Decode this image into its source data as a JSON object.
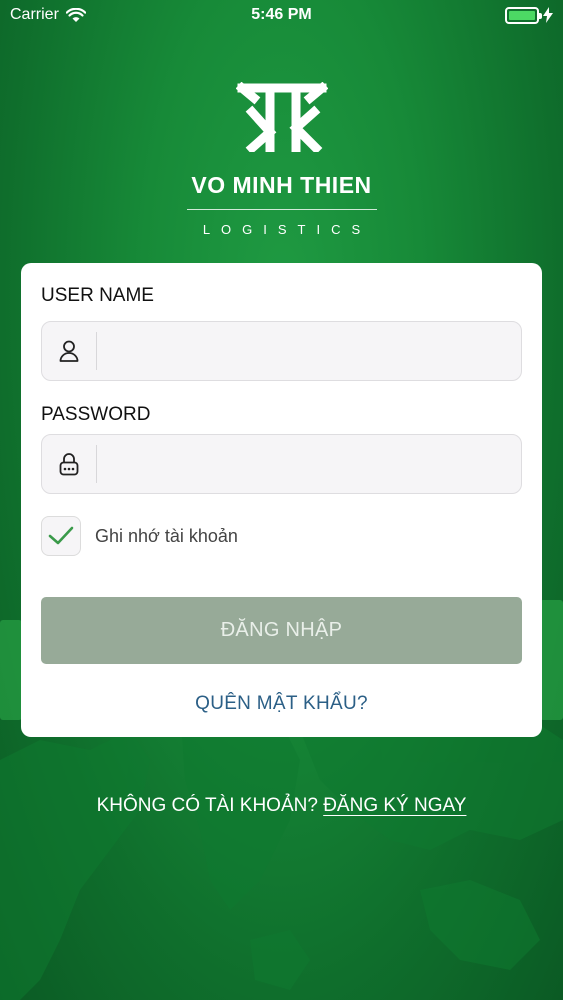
{
  "status_bar": {
    "carrier": "Carrier",
    "time": "5:46 PM",
    "battery_color": "#4cd964"
  },
  "brand": {
    "name": "VO MINH THIEN",
    "subtitle": "LOGISTICS"
  },
  "form": {
    "username_label": "USER NAME",
    "username_value": "",
    "password_label": "PASSWORD",
    "password_value": "",
    "remember_label": "Ghi nhớ tài khoản",
    "remember_checked": true,
    "login_label": "ĐĂNG NHẬP",
    "forgot_label": "QUÊN MẬT KHẨU?"
  },
  "signup": {
    "prompt": "KHÔNG CÓ TÀI KHOẢN?",
    "link": "ĐĂNG KÝ NGAY"
  },
  "colors": {
    "background": "#178a38",
    "button": "#97aa98",
    "link": "#2b5f86",
    "check": "#3a9a4a"
  }
}
